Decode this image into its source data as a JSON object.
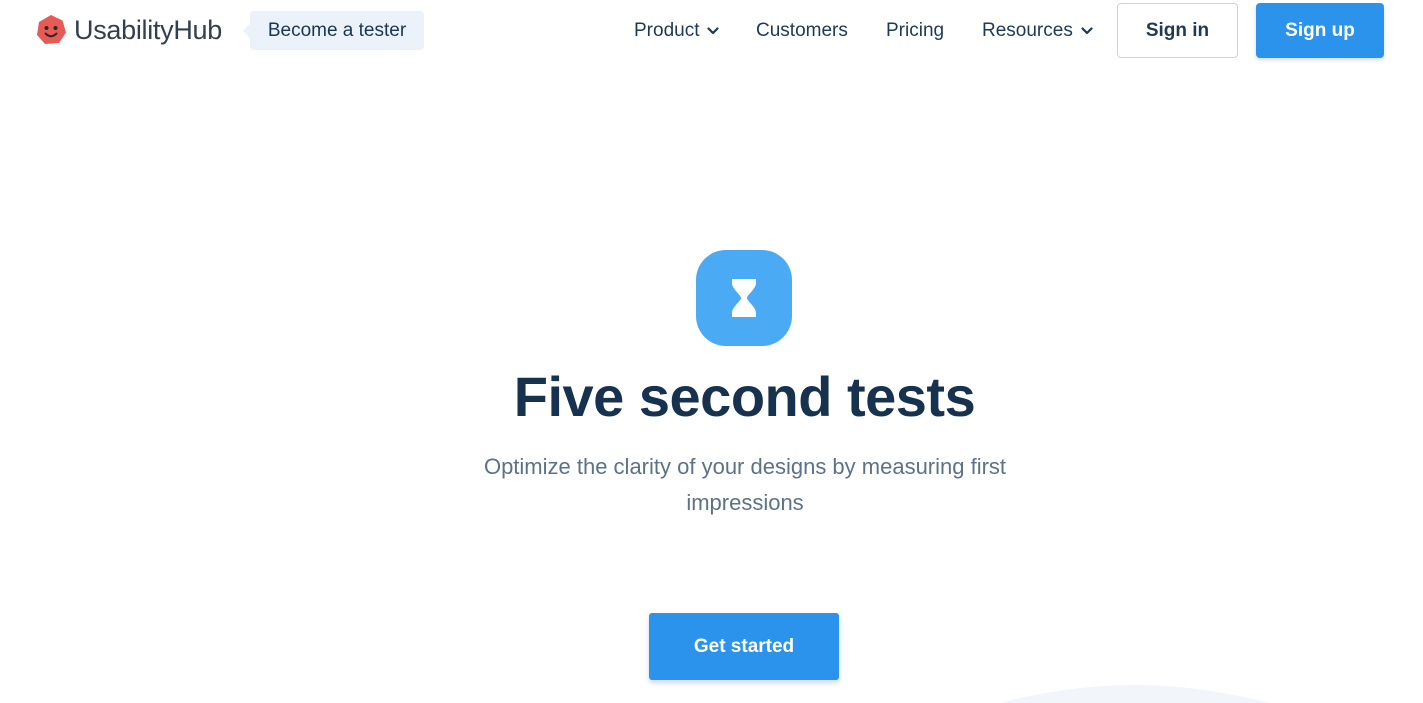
{
  "header": {
    "brand": "UsabilityHub",
    "logo_icon": "smiling-heptagon-logo",
    "tester_badge": "Become a tester",
    "nav": [
      {
        "label": "Product",
        "has_dropdown": true
      },
      {
        "label": "Customers",
        "has_dropdown": false
      },
      {
        "label": "Pricing",
        "has_dropdown": false
      },
      {
        "label": "Resources",
        "has_dropdown": true
      }
    ],
    "sign_in": "Sign in",
    "sign_up": "Sign up"
  },
  "hero": {
    "icon": "hourglass-icon",
    "title": "Five second tests",
    "subtitle": "Optimize the clarity of your designs by measuring first impressions",
    "cta": "Get started"
  },
  "colors": {
    "primary": "#2b93ec",
    "icon_bg": "#4aaaf4",
    "heading": "#16324f",
    "logo": "#e85a55",
    "badge_bg": "#ecf2f9"
  }
}
